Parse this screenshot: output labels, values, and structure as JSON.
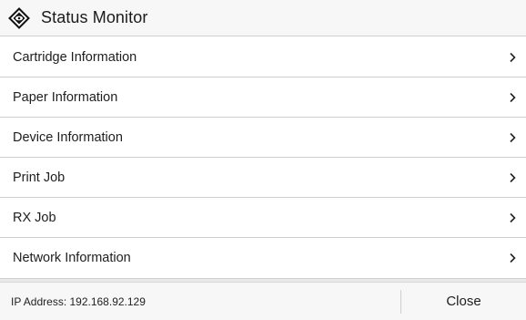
{
  "header": {
    "title": "Status Monitor",
    "icon": "status-monitor-diamond-icon"
  },
  "menu": {
    "items": [
      {
        "label": "Cartridge Information",
        "icon": "chevron-right-icon"
      },
      {
        "label": "Paper Information",
        "icon": "chevron-right-icon"
      },
      {
        "label": "Device Information",
        "icon": "chevron-right-icon"
      },
      {
        "label": "Print Job",
        "icon": "chevron-right-icon"
      },
      {
        "label": "RX Job",
        "icon": "chevron-right-icon"
      },
      {
        "label": "Network Information",
        "icon": "chevron-right-icon"
      }
    ]
  },
  "footer": {
    "ip_address": "IP Address: 192.168.92.129",
    "close_label": "Close"
  }
}
